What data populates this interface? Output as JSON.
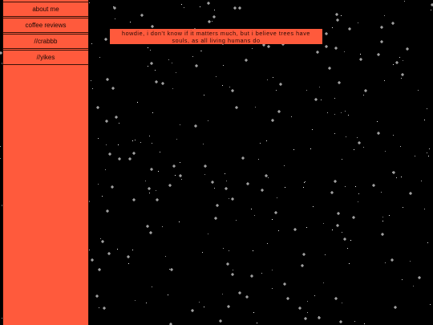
{
  "sidebar": {
    "items": [
      {
        "label": "about me"
      },
      {
        "label": "coffee reviews"
      },
      {
        "label": "//crabbb"
      },
      {
        "label": "//yikes"
      }
    ]
  },
  "quote": {
    "text": "howdie, i don't know if it matters much, but i believe trees have souls, as all living humans do"
  },
  "colors": {
    "background": "#000000",
    "accent": "#ff5a3c",
    "star": "#ffffff"
  }
}
